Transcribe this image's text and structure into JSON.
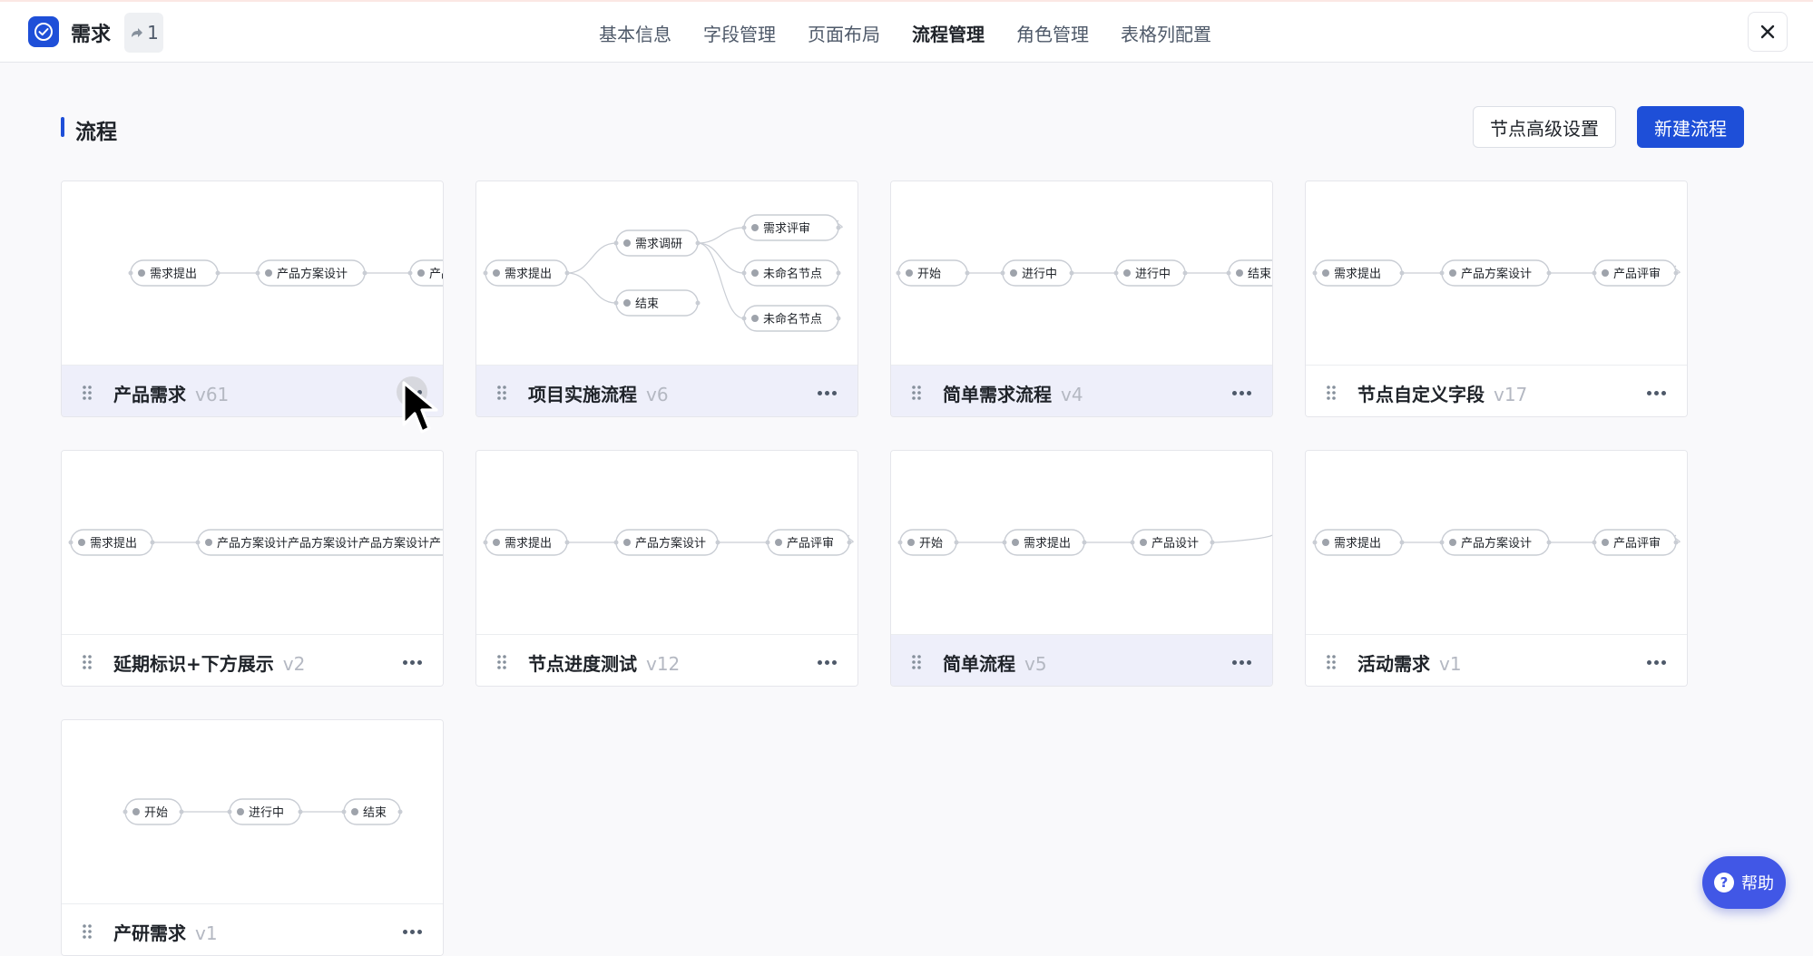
{
  "header": {
    "app_title": "需求",
    "share_count": "1",
    "nav_tabs": [
      "基本信息",
      "字段管理",
      "页面布局",
      "流程管理",
      "角色管理",
      "表格列配置"
    ],
    "active_tab_index": 3
  },
  "section": {
    "title": "流程",
    "advanced_button": "节点高级设置",
    "new_button": "新建流程"
  },
  "colors": {
    "accent": "#1e4fd8",
    "hover_bg": "#eeeffa",
    "help_bg": "#4157e6"
  },
  "cards": [
    {
      "name": "产品需求",
      "version": "v61",
      "nodes": [
        "需求提出",
        "产品方案设计",
        "产品评审"
      ],
      "highlighted": true,
      "more_hover": true
    },
    {
      "name": "项目实施流程",
      "version": "v6",
      "nodes": [
        "需求提出",
        "需求调研",
        "结束",
        "需求评审",
        "未命名节点",
        "未命名节点"
      ],
      "highlighted": true
    },
    {
      "name": "简单需求流程",
      "version": "v4",
      "nodes": [
        "开始",
        "进行中",
        "进行中",
        "结束"
      ],
      "highlighted": true
    },
    {
      "name": "节点自定义字段",
      "version": "v17",
      "nodes": [
        "需求提出",
        "产品方案设计",
        "产品评审"
      ],
      "highlighted": false
    },
    {
      "name": "延期标识+下方展示",
      "version": "v2",
      "nodes": [
        "需求提出",
        "产品方案设计产品方案设计产品方案设计产"
      ],
      "highlighted": false
    },
    {
      "name": "节点进度测试",
      "version": "v12",
      "nodes": [
        "需求提出",
        "产品方案设计",
        "产品评审"
      ],
      "highlighted": false
    },
    {
      "name": "简单流程",
      "version": "v5",
      "nodes": [
        "开始",
        "需求提出",
        "产品设计"
      ],
      "highlighted": true
    },
    {
      "name": "活动需求",
      "version": "v1",
      "nodes": [
        "需求提出",
        "产品方案设计",
        "产品评审"
      ],
      "highlighted": false
    },
    {
      "name": "产研需求",
      "version": "v1",
      "nodes": [
        "开始",
        "进行中",
        "结束"
      ],
      "highlighted": false
    }
  ],
  "help": {
    "label": "帮助",
    "icon": "question-icon"
  }
}
